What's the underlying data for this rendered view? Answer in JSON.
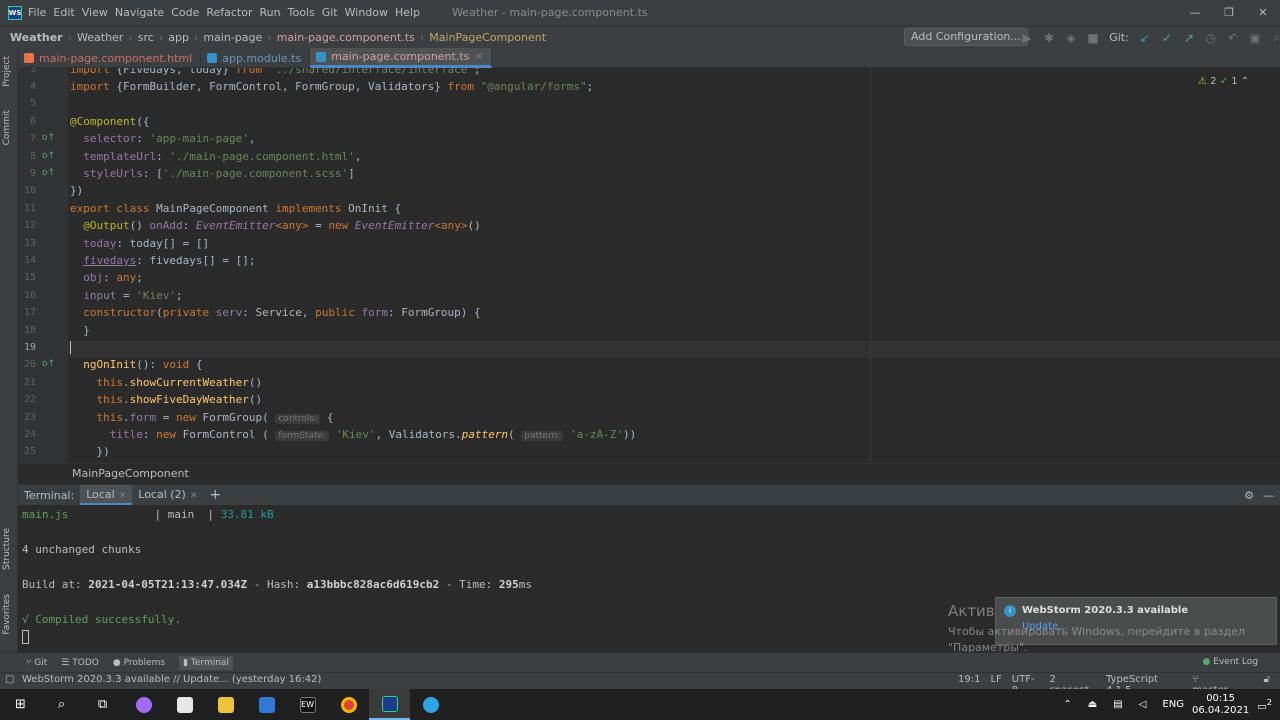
{
  "window": {
    "title": "Weather - main-page.component.ts",
    "logo_text": "WS",
    "menu": [
      "File",
      "Edit",
      "View",
      "Navigate",
      "Code",
      "Refactor",
      "Run",
      "Tools",
      "Git",
      "Window",
      "Help"
    ],
    "controls": [
      "—",
      "❐",
      "✕"
    ]
  },
  "breadcrumbs": {
    "items": [
      "Weather",
      "Weather",
      "src",
      "app",
      "main-page",
      "main-page.component.ts",
      "MainPageComponent"
    ]
  },
  "toolbar": {
    "add_configuration": "Add Configuration...",
    "git_label": "Git:"
  },
  "side_tabs": {
    "project": "Project",
    "commit": "Commit",
    "structure": "Structure",
    "favorites": "Favorites"
  },
  "editor_tabs": [
    {
      "name": "main-page.component.html",
      "type": "html",
      "active": false
    },
    {
      "name": "app.module.ts",
      "type": "ts",
      "active": false
    },
    {
      "name": "main-page.component.ts",
      "type": "ts",
      "active": true
    }
  ],
  "inspections": {
    "warnings": "2",
    "checks": "1"
  },
  "editor": {
    "line_numbers": [
      "3",
      "4",
      "5",
      "6",
      "7",
      "8",
      "9",
      "10",
      "11",
      "12",
      "13",
      "14",
      "15",
      "16",
      "17",
      "18",
      "19",
      "20",
      "21",
      "22",
      "23",
      "24",
      "25"
    ],
    "current_line": "19",
    "gutter_markers": {
      "7": "o↑",
      "8": "o↑",
      "9": "o↑",
      "20": "o↑"
    },
    "breadcrumb": "MainPageComponent"
  },
  "terminal": {
    "label": "Terminal:",
    "tabs": [
      "Local",
      "Local (2)"
    ],
    "add": "+",
    "output": {
      "file": "main.js",
      "chunk_sep": "| main  |",
      "size": "33.81 kB",
      "unchanged": "4 unchanged chunks",
      "build_prefix": "Build at: ",
      "build_time": "2021-04-05T21:13:47.034Z",
      "hash_prefix": " - Hash: ",
      "hash": "a13bbbc828ac6d619cb2",
      "time_prefix": " - Time: ",
      "time": "295",
      "time_unit": "ms",
      "compiled": "√ Compiled successfully."
    }
  },
  "notification": {
    "title": "WebStorm 2020.3.3 available",
    "link": "Update..."
  },
  "watermark": {
    "title": "Активация Windows",
    "text": "Чтобы активировать Windows, перейдите в раздел \"Параметры\"."
  },
  "tool_windows": [
    "Git",
    "TODO",
    "Problems",
    "Terminal"
  ],
  "event_log": "Event Log",
  "status": {
    "message": "WebStorm 2020.3.3 available // Update... (yesterday 16:42)",
    "position": "19:1",
    "line_sep": "LF",
    "encoding": "UTF-8",
    "indent": "2 spaces*",
    "language": "TypeScript 4.1.5",
    "branch": "master"
  },
  "taskbar": {
    "lang": "ENG",
    "time": "00:15",
    "date": "06.04.2021",
    "notif_count": "2"
  }
}
